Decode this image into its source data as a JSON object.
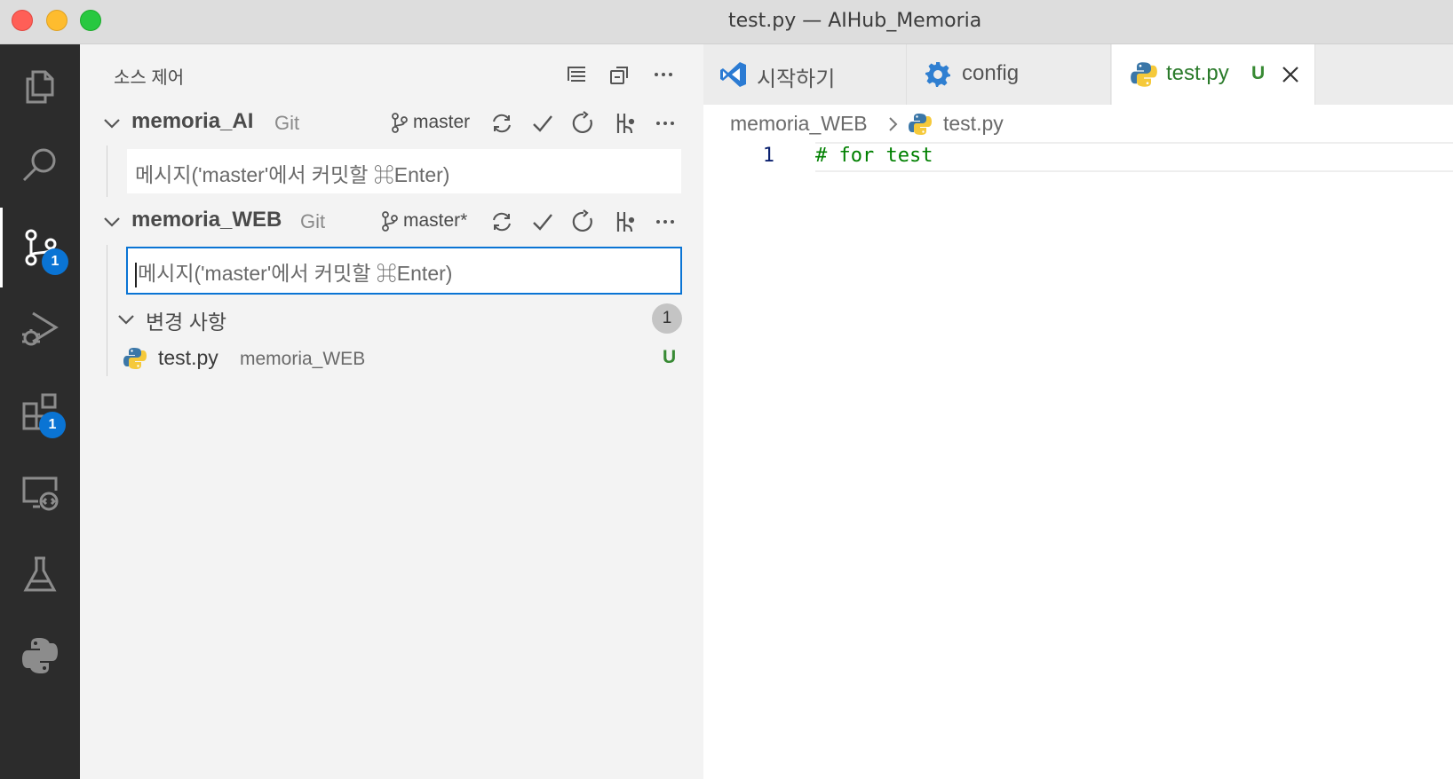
{
  "window": {
    "title": "test.py — AIHub_Memoria"
  },
  "activity_bar": {
    "items": [
      {
        "icon": "files-icon"
      },
      {
        "icon": "search-icon"
      },
      {
        "icon": "source-control-icon",
        "badge": "1",
        "active": true
      },
      {
        "icon": "run-debug-icon"
      },
      {
        "icon": "extensions-icon",
        "badge": "1"
      },
      {
        "icon": "remote-explorer-icon"
      },
      {
        "icon": "testing-icon"
      },
      {
        "icon": "python-icon"
      }
    ]
  },
  "sidebar": {
    "title": "소스 제어",
    "repos": [
      {
        "name": "memoria_AI",
        "vcs": "Git",
        "branch": "master",
        "message_placeholder": "메시지('master'에서 커밋할 ⌘Enter)"
      },
      {
        "name": "memoria_WEB",
        "vcs": "Git",
        "branch": "master*",
        "message_placeholder": "메시지('master'에서 커밋할 ⌘Enter)",
        "changes": {
          "label": "변경 사항",
          "count": "1",
          "files": [
            {
              "name": "test.py",
              "path": "memoria_WEB",
              "status": "U"
            }
          ]
        }
      }
    ]
  },
  "editor": {
    "tabs": [
      {
        "label": "시작하기",
        "icon": "vscode-icon"
      },
      {
        "label": "config",
        "icon": "gear-icon"
      },
      {
        "label": "test.py",
        "icon": "python-icon",
        "status": "U",
        "active": true
      }
    ],
    "breadcrumb": [
      "memoria_WEB",
      "test.py"
    ],
    "lines": [
      {
        "number": "1",
        "text": "# for test"
      }
    ]
  },
  "colors": {
    "accent": "#0a74d4",
    "untracked": "#388a34",
    "activity_bg": "#2c2c2c",
    "sidebar_bg": "#f3f3f3"
  }
}
